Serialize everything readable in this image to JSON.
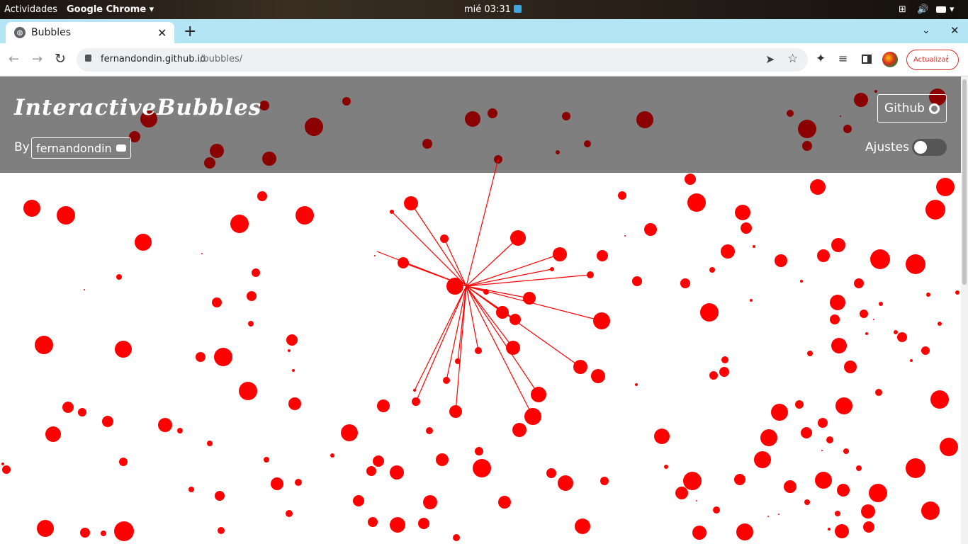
{
  "system": {
    "activities": "Actividades",
    "app": "Google Chrome",
    "clock": "mié 03:31"
  },
  "browser": {
    "tab_title": "Bubbles",
    "url_host": "fernandondin.github.io",
    "url_path": "/bubbles/",
    "update_label": "Actualizar"
  },
  "page": {
    "title": "InteractiveBubbles",
    "by": "By",
    "author": "fernandondin",
    "github": "Github",
    "settings": "Ajustes"
  },
  "colors": {
    "bubble": "#ff0000",
    "header_bubble": "#8b0000",
    "header_bg": "#7f7f7f",
    "tab_strip": "#b3e5f4"
  },
  "bubbles": [
    [
      45,
      294,
      12
    ],
    [
      93,
      304,
      13
    ],
    [
      202,
      342,
      12
    ],
    [
      338,
      316,
      13
    ],
    [
      370,
      277,
      7
    ],
    [
      430,
      304,
      13
    ],
    [
      168,
      391,
      4
    ],
    [
      119,
      409,
      1
    ],
    [
      285,
      358,
      1
    ],
    [
      361,
      385,
      6
    ],
    [
      355,
      418,
      7
    ],
    [
      306,
      427,
      7
    ],
    [
      354,
      457,
      4
    ],
    [
      62,
      487,
      13
    ],
    [
      174,
      493,
      12
    ],
    [
      412,
      480,
      8
    ],
    [
      408,
      495,
      2
    ],
    [
      414,
      523,
      2
    ],
    [
      283,
      504,
      7
    ],
    [
      315,
      504,
      13
    ],
    [
      350,
      552,
      13
    ],
    [
      96,
      575,
      8
    ],
    [
      116,
      582,
      6
    ],
    [
      152,
      595,
      8
    ],
    [
      75,
      613,
      11
    ],
    [
      233,
      600,
      10
    ],
    [
      254,
      608,
      4
    ],
    [
      296,
      626,
      4
    ],
    [
      174,
      652,
      6
    ],
    [
      9,
      663,
      6
    ],
    [
      4,
      655,
      2
    ],
    [
      270,
      691,
      4
    ],
    [
      310,
      700,
      7
    ],
    [
      376,
      649,
      4
    ],
    [
      391,
      683,
      9
    ],
    [
      421,
      681,
      5
    ],
    [
      408,
      725,
      5
    ],
    [
      64,
      746,
      12
    ],
    [
      120,
      752,
      7
    ],
    [
      146,
      753,
      4
    ],
    [
      175,
      750,
      14
    ],
    [
      312,
      749,
      5
    ],
    [
      416,
      570,
      9
    ],
    [
      493,
      611,
      12
    ],
    [
      469,
      643,
      3
    ],
    [
      541,
      573,
      9
    ],
    [
      580,
      287,
      10
    ],
    [
      553,
      299,
      3
    ],
    [
      627,
      337,
      6
    ],
    [
      529,
      361,
      1
    ],
    [
      569,
      371,
      8
    ],
    [
      642,
      404,
      12
    ],
    [
      686,
      412,
      4
    ],
    [
      731,
      336,
      11
    ],
    [
      790,
      359,
      10
    ],
    [
      779,
      380,
      3
    ],
    [
      850,
      361,
      8
    ],
    [
      833,
      388,
      5
    ],
    [
      747,
      421,
      9
    ],
    [
      709,
      441,
      9
    ],
    [
      727,
      451,
      8
    ],
    [
      849,
      453,
      12
    ],
    [
      724,
      491,
      10
    ],
    [
      675,
      495,
      5
    ],
    [
      646,
      510,
      4
    ],
    [
      630,
      537,
      5
    ],
    [
      585,
      551,
      2
    ],
    [
      587,
      567,
      6
    ],
    [
      643,
      581,
      9
    ],
    [
      606,
      608,
      5
    ],
    [
      819,
      518,
      10
    ],
    [
      844,
      531,
      10
    ],
    [
      760,
      557,
      11
    ],
    [
      752,
      588,
      12
    ],
    [
      733,
      607,
      10
    ],
    [
      676,
      637,
      6
    ],
    [
      680,
      661,
      13
    ],
    [
      624,
      649,
      9
    ],
    [
      534,
      651,
      8
    ],
    [
      524,
      665,
      7
    ],
    [
      560,
      667,
      10
    ],
    [
      506,
      707,
      8
    ],
    [
      607,
      709,
      10
    ],
    [
      526,
      737,
      7
    ],
    [
      561,
      741,
      11
    ],
    [
      598,
      739,
      8
    ],
    [
      644,
      759,
      5
    ],
    [
      712,
      709,
      9
    ],
    [
      778,
      668,
      7
    ],
    [
      798,
      682,
      11
    ],
    [
      853,
      679,
      6
    ],
    [
      822,
      743,
      11
    ],
    [
      878,
      276,
      6
    ],
    [
      882,
      333,
      1
    ],
    [
      918,
      324,
      9
    ],
    [
      899,
      397,
      7
    ],
    [
      898,
      543,
      2
    ],
    [
      934,
      616,
      11
    ],
    [
      940,
      659,
      3
    ],
    [
      967,
      400,
      7
    ],
    [
      1001,
      441,
      13
    ],
    [
      974,
      253,
      8
    ],
    [
      983,
      286,
      13
    ],
    [
      1048,
      300,
      11
    ],
    [
      1053,
      322,
      8
    ],
    [
      1027,
      355,
      10
    ],
    [
      1064,
      348,
      2
    ],
    [
      1005,
      381,
      4
    ],
    [
      1060,
      424,
      2
    ],
    [
      1023,
      508,
      5
    ],
    [
      1022,
      525,
      7
    ],
    [
      1007,
      530,
      6
    ],
    [
      1102,
      368,
      9
    ],
    [
      1131,
      397,
      2
    ],
    [
      1154,
      264,
      11
    ],
    [
      1162,
      361,
      9
    ],
    [
      1183,
      346,
      10
    ],
    [
      1242,
      366,
      14
    ],
    [
      1292,
      373,
      14
    ],
    [
      1212,
      400,
      7
    ],
    [
      1182,
      427,
      11
    ],
    [
      1178,
      451,
      7
    ],
    [
      1219,
      443,
      6
    ],
    [
      1243,
      429,
      3
    ],
    [
      1233,
      451,
      1
    ],
    [
      1223,
      471,
      2
    ],
    [
      1264,
      469,
      3
    ],
    [
      1273,
      476,
      7
    ],
    [
      1310,
      416,
      3
    ],
    [
      1326,
      457,
      3
    ],
    [
      1351,
      413,
      3
    ],
    [
      1184,
      488,
      11
    ],
    [
      1143,
      499,
      4
    ],
    [
      1200,
      518,
      9
    ],
    [
      1286,
      509,
      2
    ],
    [
      1306,
      495,
      6
    ],
    [
      1334,
      264,
      13
    ],
    [
      1320,
      296,
      14
    ],
    [
      1100,
      582,
      12
    ],
    [
      1128,
      571,
      6
    ],
    [
      1085,
      618,
      12
    ],
    [
      1138,
      611,
      8
    ],
    [
      1161,
      597,
      7
    ],
    [
      1191,
      573,
      12
    ],
    [
      1240,
      554,
      5
    ],
    [
      1326,
      564,
      13
    ],
    [
      1339,
      631,
      13
    ],
    [
      1171,
      621,
      5
    ],
    [
      1194,
      637,
      4
    ],
    [
      1160,
      636,
      1
    ],
    [
      1076,
      649,
      12
    ],
    [
      1212,
      661,
      4
    ],
    [
      1292,
      661,
      14
    ],
    [
      1044,
      677,
      8
    ],
    [
      977,
      679,
      13
    ],
    [
      962,
      696,
      9
    ],
    [
      983,
      707,
      1
    ],
    [
      1011,
      720,
      5
    ],
    [
      1115,
      687,
      9
    ],
    [
      1139,
      709,
      4
    ],
    [
      1162,
      678,
      12
    ],
    [
      1190,
      692,
      9
    ],
    [
      1239,
      696,
      13
    ],
    [
      1182,
      725,
      4
    ],
    [
      1225,
      722,
      10
    ],
    [
      1313,
      721,
      13
    ],
    [
      1226,
      744,
      8
    ],
    [
      1188,
      750,
      10
    ],
    [
      1170,
      747,
      2
    ],
    [
      1084,
      729,
      1
    ],
    [
      1099,
      726,
      1
    ],
    [
      1051,
      751,
      12
    ],
    [
      987,
      752,
      10
    ]
  ],
  "header_bubbles": [
    [
      190,
      193,
      8
    ],
    [
      210,
      168,
      12
    ],
    [
      306,
      213,
      10
    ],
    [
      296,
      230,
      8
    ],
    [
      373,
      149,
      7
    ],
    [
      380,
      224,
      10
    ],
    [
      443,
      179,
      13
    ],
    [
      489,
      143,
      6
    ],
    [
      603,
      203,
      7
    ],
    [
      667,
      168,
      11
    ],
    [
      695,
      160,
      7
    ],
    [
      703,
      225,
      6
    ],
    [
      799,
      164,
      6
    ],
    [
      829,
      203,
      5
    ],
    [
      787,
      215,
      3
    ],
    [
      910,
      169,
      12
    ],
    [
      1115,
      160,
      5
    ],
    [
      1139,
      182,
      13
    ],
    [
      1139,
      206,
      7
    ],
    [
      1186,
      164,
      1
    ],
    [
      1196,
      182,
      6
    ],
    [
      1215,
      141,
      10
    ],
    [
      1236,
      129,
      2
    ],
    [
      1323,
      137,
      12
    ]
  ],
  "links": [
    [
      703,
      225
    ],
    [
      580,
      287
    ],
    [
      553,
      299
    ],
    [
      627,
      337
    ],
    [
      532,
      355
    ],
    [
      569,
      371
    ],
    [
      731,
      336
    ],
    [
      790,
      359
    ],
    [
      779,
      380
    ],
    [
      833,
      388
    ],
    [
      747,
      421
    ],
    [
      686,
      412
    ],
    [
      709,
      441
    ],
    [
      727,
      451
    ],
    [
      849,
      453
    ],
    [
      724,
      491
    ],
    [
      675,
      495
    ],
    [
      646,
      510
    ],
    [
      630,
      537
    ],
    [
      585,
      551
    ],
    [
      587,
      567
    ],
    [
      643,
      581
    ],
    [
      819,
      518
    ],
    [
      760,
      557
    ],
    [
      752,
      588
    ]
  ],
  "link_hub": [
    658,
    404
  ]
}
